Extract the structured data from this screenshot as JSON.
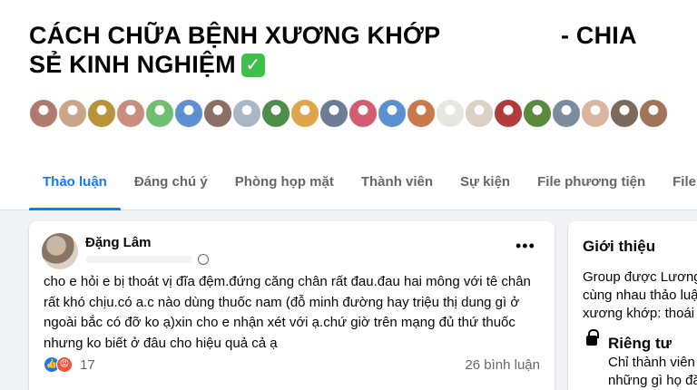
{
  "group": {
    "title_part1": "CÁCH CHỮA BỆNH XƯƠNG KHỚP",
    "title_part2": "- CHIA",
    "title_line2": "SẺ KINH NGHIỆM",
    "verified_glyph": "✓"
  },
  "member_avatar_colors": [
    "#b07a6e",
    "#c9a58c",
    "#b8933a",
    "#c98e7e",
    "#6fbf73",
    "#5d8fd3",
    "#8b6f63",
    "#a9b6c5",
    "#4d8f4a",
    "#e0a44a",
    "#6b7c94",
    "#d35d6e",
    "#5a8fd0",
    "#c87a4a",
    "#e8e6e0",
    "#d9d0c6",
    "#b23b3b",
    "#5b8a3c",
    "#7a8c9e",
    "#d9b6a0",
    "#7d6a5b",
    "#a0735a"
  ],
  "tabs": [
    {
      "label": "Thảo luận",
      "active": true
    },
    {
      "label": "Đáng chú ý",
      "active": false
    },
    {
      "label": "Phòng họp mặt",
      "active": false
    },
    {
      "label": "Thành viên",
      "active": false
    },
    {
      "label": "Sự kiện",
      "active": false
    },
    {
      "label": "File phương tiện",
      "active": false
    },
    {
      "label": "File",
      "active": false
    }
  ],
  "post": {
    "author": "Đặng Lâm",
    "more_glyph": "•••",
    "body": "cho e hỏi e bị thoát vị đĩa đệm.đứng căng chân rất đau.đau hai mông với tê chân rất khó chịu.có a.c nào dùng thuốc nam (đỗ minh đường hay triệu thị dung gì ở ngoài bắc có đỡ ko ạ)xin cho e nhận xét với ạ.chứ giờ trên mạng đủ thứ thuốc nhưng ko biết ở đâu cho hiệu quả cả ạ",
    "like_glyph": "👍",
    "angry_glyph": "😡",
    "reaction_count": "17",
    "comments": "26 bình luận"
  },
  "about": {
    "heading": "Giới thiệu",
    "description": "Group được Lương cùng nhau thảo luậ xương khớp: thoái k",
    "privacy_title": "Riêng tư",
    "privacy_desc": "Chỉ thành viên những gì họ đă"
  },
  "colors": {
    "accent": "#1877f2",
    "background": "#f0f2f5",
    "secondary_text": "#65676b"
  }
}
